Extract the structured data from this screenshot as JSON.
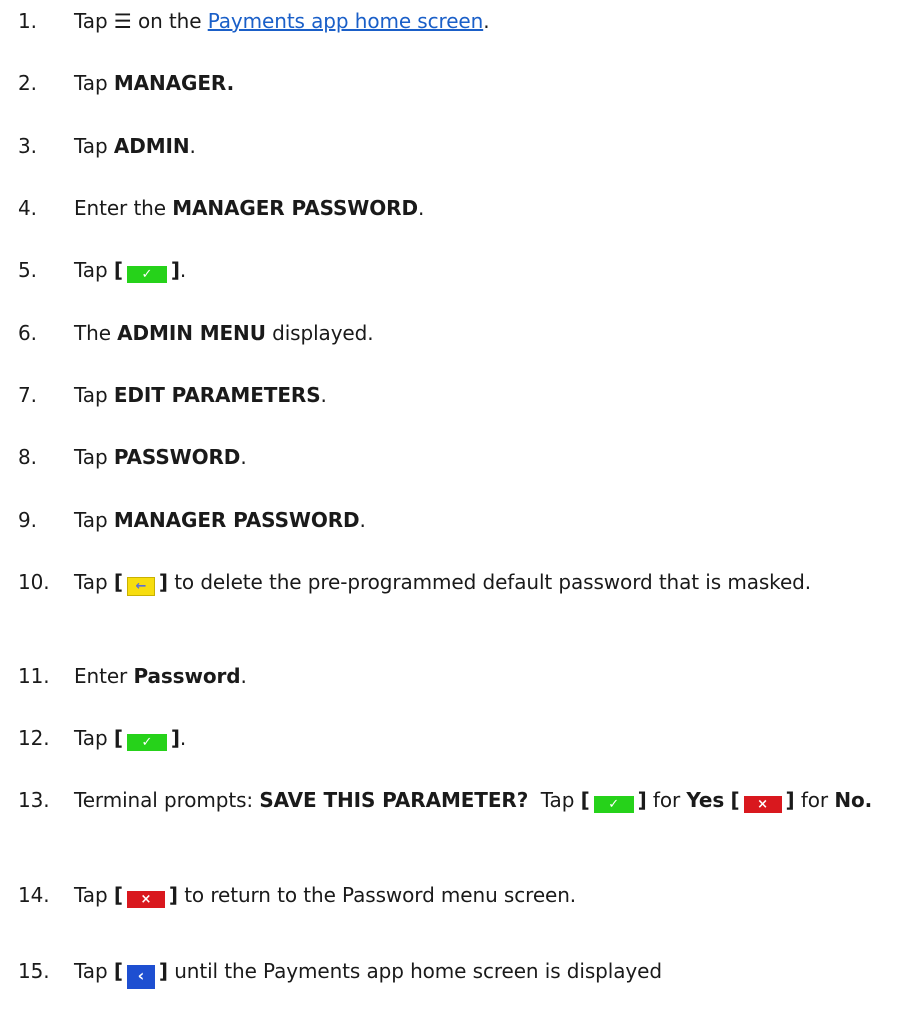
{
  "steps": [
    {
      "num": "1.",
      "tap": "Tap",
      "icon": "menu-icon",
      "on_the": "on the",
      "link": "Payments app home screen",
      "end": "."
    },
    {
      "num": "2.",
      "tap": "Tap",
      "bold": "MANAGER."
    },
    {
      "num": "3.",
      "tap": "Tap",
      "bold": "ADMIN",
      "end": "."
    },
    {
      "num": "4.",
      "lead": "Enter the",
      "bold": "MANAGER PASSWORD",
      "end": "."
    },
    {
      "num": "5.",
      "tap": "Tap",
      "key": "confirm-key-green",
      "end": "."
    },
    {
      "num": "6.",
      "lead": "The",
      "bold": "ADMIN MENU",
      "tail": "displayed."
    },
    {
      "num": "7.",
      "tap": "Tap",
      "bold": "EDIT PARAMETERS",
      "end": "."
    },
    {
      "num": "8.",
      "tap": "Tap",
      "bold": "PASSWORD",
      "end": "."
    },
    {
      "num": "9.",
      "tap": "Tap",
      "bold": "MANAGER PASSWORD",
      "end": "."
    },
    {
      "num": "10.",
      "tap": "Tap",
      "key": "backspace-key-yellow",
      "tail": "to delete the pre-programmed default password that is masked."
    },
    {
      "num": "11.",
      "lead": "Enter",
      "bold": "Password",
      "end": "."
    },
    {
      "num": "12.",
      "tap": "Tap",
      "key": "confirm-key-green",
      "end": "."
    },
    {
      "num": "13.",
      "lead": "Terminal prompts:",
      "bold": "SAVE THIS PARAMETER?",
      "tap": "Tap",
      "key": "confirm-key-green",
      "for1": "for",
      "yes": "Yes",
      "key2": "cancel-key-red",
      "for2": "for",
      "no": "No."
    },
    {
      "num": "14.",
      "tap": "Tap",
      "key": "cancel-key-red",
      "tail": "to return to the Password menu screen."
    },
    {
      "num": "15.",
      "tap": "Tap",
      "key": "back-key-blue",
      "tail": "until the Payments app home screen is displayed"
    }
  ],
  "glyphs": {
    "menu": "☰",
    "check": "✓",
    "cross": "×",
    "arrow_left": "←",
    "arrow_back": "‹",
    "bracket_open": "[",
    "bracket_close": "]"
  },
  "colors": {
    "link": "#1a5fc8",
    "green_key": "#26d21a",
    "yellow_key": "#f7dd0e",
    "red_key": "#d9181e",
    "blue_key": "#1e4fd1"
  }
}
